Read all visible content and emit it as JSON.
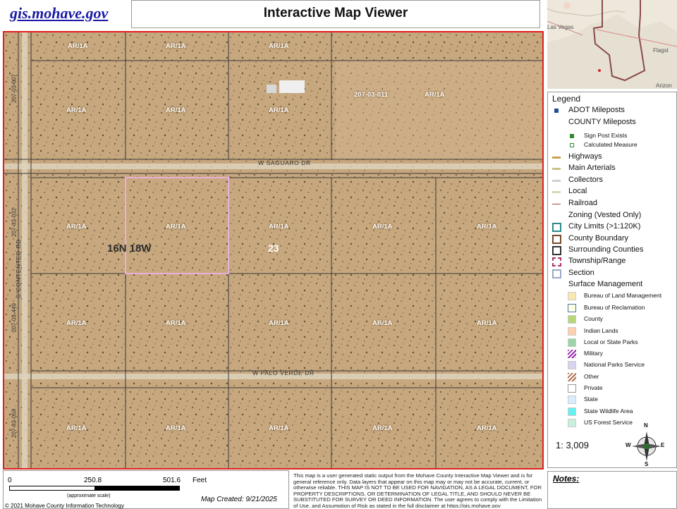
{
  "header": {
    "site_link": "gis.mohave.gov",
    "title": "Interactive Map Viewer"
  },
  "map": {
    "parcel_ids": [
      "207-03-011",
      "207-03-007",
      "207-03-032",
      "207-03-449",
      "207-03-059"
    ],
    "zoning_label": "AR/1A",
    "streets": [
      "W SAGUARO DR",
      "W PALO VERDE DR",
      "S CONTENTED RD"
    ],
    "township_range": "16N 18W",
    "section": "23"
  },
  "inset": {
    "places": [
      "Las Vegas",
      "Flagst",
      "Arizon"
    ]
  },
  "legend": {
    "title": "Legend",
    "items": [
      {
        "label": "ADOT Mileposts",
        "style": "small",
        "color": "#1f4e9a",
        "icon": "square-marker"
      },
      {
        "label": "COUNTY Mileposts",
        "style": "header"
      },
      {
        "label": "Sign Post Exists",
        "style": "sub",
        "color": "#2e8b2e",
        "icon": "square-marker"
      },
      {
        "label": "Calculated Measure",
        "style": "sub",
        "color": "#2e8b2e",
        "icon": "dot-in-square"
      },
      {
        "label": "Highways",
        "style": "line",
        "color": "#c9a24a"
      },
      {
        "label": "Main Arterials",
        "style": "line",
        "color": "#c8c28a"
      },
      {
        "label": "Collectors",
        "style": "line",
        "color": "#d0d0d0"
      },
      {
        "label": "Local",
        "style": "line",
        "color": "#d9d9b5"
      },
      {
        "label": "Railroad",
        "style": "rail",
        "color": "#9b4444"
      },
      {
        "label": "Zoning (Vested Only)",
        "style": "header"
      },
      {
        "label": "City Limits (>1:120K)",
        "style": "box",
        "color": "#2c8c8c"
      },
      {
        "label": "County Boundary",
        "style": "box",
        "color": "#7a4a2a"
      },
      {
        "label": "Surrounding Counties",
        "style": "box",
        "color": "#333333"
      },
      {
        "label": "Township/Range",
        "style": "dashbox",
        "color": "#b0306a"
      },
      {
        "label": "Section",
        "style": "box",
        "color": "#9aa8c8"
      },
      {
        "label": "Surface Management",
        "style": "header"
      },
      {
        "label": "Bureau of Land Management",
        "style": "fill",
        "color": "#fbe7b0"
      },
      {
        "label": "Bureau of Reclamation",
        "style": "fill",
        "color": "#ffffe0",
        "border": "#4a79b0"
      },
      {
        "label": "County",
        "style": "fill",
        "color": "#b5d77a"
      },
      {
        "label": "Indian Lands",
        "style": "fill",
        "color": "#fcd0b0"
      },
      {
        "label": "Local or State Parks",
        "style": "fill",
        "color": "#9bd4a5"
      },
      {
        "label": "Military",
        "style": "hatch",
        "color": "#9a2ab0"
      },
      {
        "label": "National Parks Service",
        "style": "fill",
        "color": "#d9d2f0"
      },
      {
        "label": "Other",
        "style": "hatch",
        "color": "#b07050"
      },
      {
        "label": "Private",
        "style": "fill",
        "color": "#ffffff",
        "border": "#999999"
      },
      {
        "label": "State",
        "style": "fill",
        "color": "#d9eefc"
      },
      {
        "label": "State Wildlife Area",
        "style": "fill",
        "color": "#66f0f0"
      },
      {
        "label": "US Forest Service",
        "style": "fill",
        "color": "#c8f0dc"
      }
    ],
    "scale_ratio": "1: 3,009",
    "compass": {
      "n": "N",
      "s": "S",
      "e": "E",
      "w": "W"
    }
  },
  "scalebar": {
    "ticks": [
      "0",
      "250.8",
      "501.6"
    ],
    "unit": "Feet",
    "note": "(approximate scale)",
    "copyright": "© 2021 Mohave County Information Technology",
    "map_created": "Map Created: 9/21/2025"
  },
  "disclaimer": "This map is a user generated static output from the Mohave County Interactive Map Viewer and is for general reference only. Data layers that appear on this map may or may not be accurate, current, or otherwise reliable. THIS MAP IS NOT TO BE USED FOR NAVIGATION, AS A LEGAL DOCUMENT, FOR PROPERTY DESCRIPTIONS, OR DETERMINATION OF LEGAL TITLE, AND SHOULD NEVER BE SUBSTITUTED FOR SURVEY OR DEED INFORMATION. The user agrees to comply with the Limitation of Use, and Assumption of Risk as stated in the full disclaimer at https://gis.mohave.gov",
  "notes": {
    "title": "Notes:"
  }
}
